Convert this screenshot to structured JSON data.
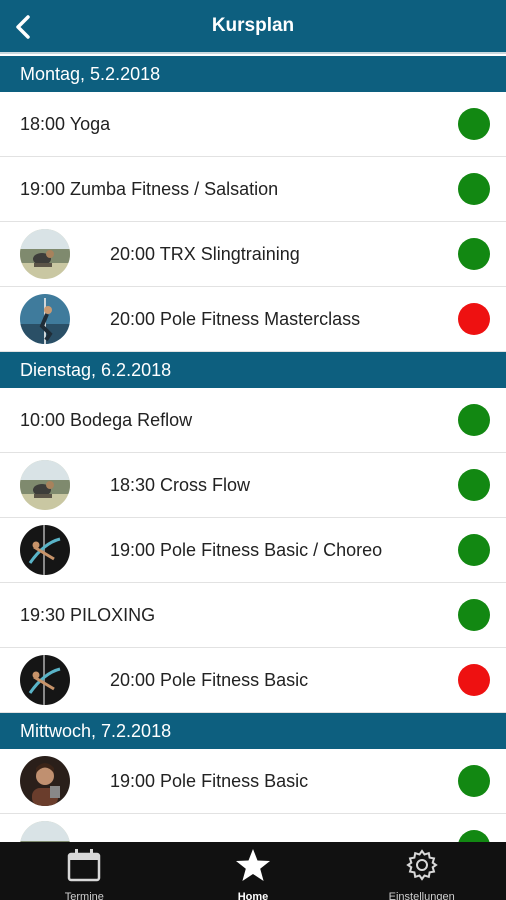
{
  "header": {
    "title": "Kursplan"
  },
  "colors": {
    "header_bg": "#0d5f7f",
    "available": "#128812",
    "full": "#ee1111"
  },
  "sections": [
    {
      "date": "Montag, 5.2.2018",
      "courses": [
        {
          "label": "18:00 Yoga",
          "status": "available",
          "avatar": null
        },
        {
          "label": "19:00 Zumba Fitness / Salsation",
          "status": "available",
          "avatar": null
        },
        {
          "label": "20:00 TRX Slingtraining",
          "status": "available",
          "avatar": "trx"
        },
        {
          "label": "20:00 Pole Fitness Masterclass",
          "status": "full",
          "avatar": "pole-outdoor"
        }
      ]
    },
    {
      "date": "Dienstag, 6.2.2018",
      "courses": [
        {
          "label": "10:00 Bodega Reflow",
          "status": "available",
          "avatar": null
        },
        {
          "label": "18:30 Cross Flow",
          "status": "available",
          "avatar": "trx"
        },
        {
          "label": "19:00 Pole Fitness Basic / Choreo",
          "status": "available",
          "avatar": "pole-dark"
        },
        {
          "label": "19:30 PILOXING",
          "status": "available",
          "avatar": null
        },
        {
          "label": "20:00 Pole Fitness Basic",
          "status": "full",
          "avatar": "pole-dark"
        }
      ]
    },
    {
      "date": "Mittwoch, 7.2.2018",
      "courses": [
        {
          "label": "19:00 Pole Fitness Basic",
          "status": "available",
          "avatar": "portrait"
        },
        {
          "label": "",
          "status": "available",
          "avatar": "trx"
        }
      ]
    }
  ],
  "tabbar": [
    {
      "label": "Termine",
      "icon": "calendar-icon",
      "active": false
    },
    {
      "label": "Home",
      "icon": "star-icon",
      "active": true
    },
    {
      "label": "Einstellungen",
      "icon": "gear-icon",
      "active": false
    }
  ]
}
